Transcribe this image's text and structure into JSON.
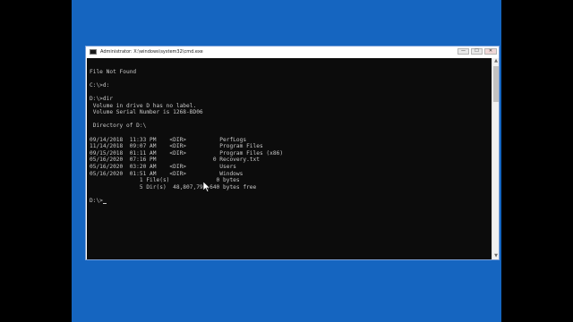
{
  "window": {
    "title": "Administrator: X:\\windows\\system32\\cmd.exe",
    "minimize_label": "—",
    "maximize_label": "☐",
    "close_label": "✕"
  },
  "console": {
    "lines": [
      "",
      "File Not Found",
      "",
      "C:\\>d:",
      "",
      "D:\\>dir",
      " Volume in drive D has no label.",
      " Volume Serial Number is 1268-BD06",
      "",
      " Directory of D:\\",
      "",
      "09/14/2018  11:33 PM    <DIR>          PerfLogs",
      "11/14/2018  09:07 AM    <DIR>          Program Files",
      "09/15/2018  01:11 AM    <DIR>          Program Files (x86)",
      "05/16/2020  07:16 PM                 0 Recovery.txt",
      "05/16/2020  03:20 AM    <DIR>          Users",
      "05/16/2020  01:51 AM    <DIR>          Windows",
      "               1 File(s)              0 bytes",
      "               5 Dir(s)  48,807,792,640 bytes free",
      "",
      "D:\\>"
    ]
  },
  "scrollbar": {
    "up_arrow": "▲",
    "down_arrow": "▼"
  },
  "colors": {
    "desktop_background": "#1565c0",
    "console_background": "#0c0c0c",
    "console_text": "#c8c8c8"
  }
}
